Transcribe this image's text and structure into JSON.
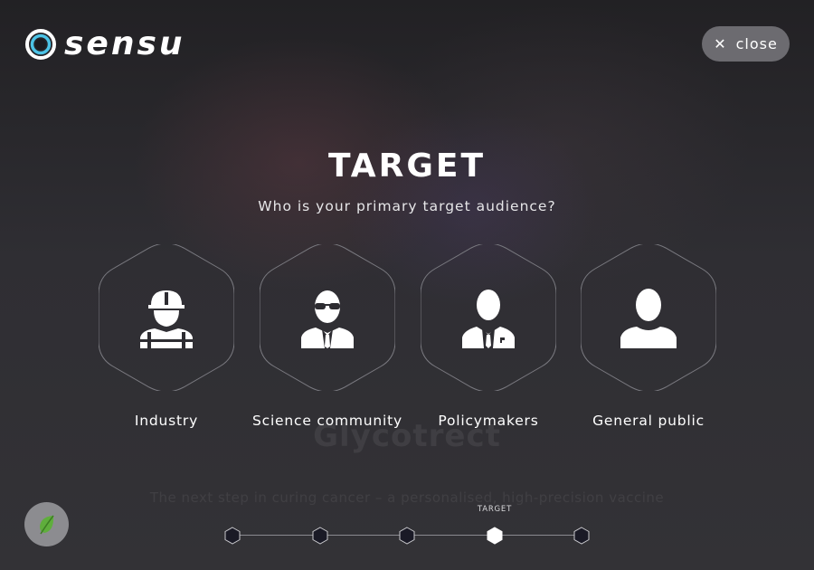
{
  "background": {
    "ghost_title": "Glycotrect",
    "ghost_subtitle": "The next step in curing cancer – a personalised, high-precision vaccine"
  },
  "logo": {
    "text": "sensu",
    "icon": "ring-logo-icon"
  },
  "close_button": {
    "label": "close",
    "icon": "close-icon"
  },
  "page": {
    "title": "TARGET",
    "question": "Who is your primary target audience?"
  },
  "options": [
    {
      "label": "Industry",
      "icon": "worker-hardhat-icon"
    },
    {
      "label": "Science community",
      "icon": "agent-sunglasses-icon"
    },
    {
      "label": "Policymakers",
      "icon": "businessman-icon"
    },
    {
      "label": "General public",
      "icon": "person-icon"
    }
  ],
  "eco_button": {
    "icon": "leaf-icon"
  },
  "stepper": {
    "current_caption": "TARGET",
    "current_step": 4,
    "total_steps": 5
  },
  "colors": {
    "accent_white": "#ffffff",
    "hex_outline": "#7a7a80",
    "step_fill": "#1a1a26",
    "close_bg": "#6c6b70",
    "leaf_green": "#5fae3c"
  }
}
